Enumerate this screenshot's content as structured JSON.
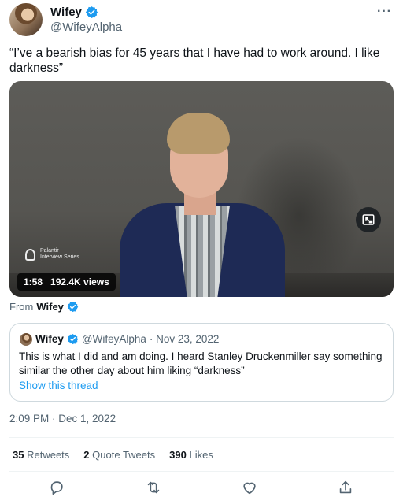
{
  "author": {
    "name": "Wifey",
    "handle": "@WifeyAlpha",
    "verified": true
  },
  "menu_icon": "more-horizontal-icon",
  "tweet": {
    "text": "“I’ve a bearish bias for 45 years that I have had to work around. I like darkness”"
  },
  "video": {
    "duration": "1:58",
    "views": "192.4K views",
    "watermark_line1": "Palantir",
    "watermark_line2": "Interview Series",
    "pip_icon": "picture-in-picture-icon"
  },
  "from_label": {
    "prefix": "From",
    "name": "Wifey"
  },
  "quoted_tweet": {
    "name": "Wifey",
    "handle": "@WifeyAlpha",
    "date": "· Nov 23, 2022",
    "text": "This is what I did and am doing. I heard Stanley Druckenmiller say something similar the other day about him liking “darkness”",
    "show_thread": "Show this thread"
  },
  "timestamp": "2:09 PM · Dec 1, 2022",
  "stats": {
    "retweets_count": "35",
    "retweets_label": "Retweets",
    "quotes_count": "2",
    "quotes_label": "Quote Tweets",
    "likes_count": "390",
    "likes_label": "Likes"
  },
  "actions": [
    "reply-icon",
    "retweet-icon",
    "like-icon",
    "share-icon"
  ],
  "colors": {
    "accent": "#1d9bf0",
    "text": "#0f1419",
    "secondary": "#536471",
    "border": "#cfd9de"
  }
}
